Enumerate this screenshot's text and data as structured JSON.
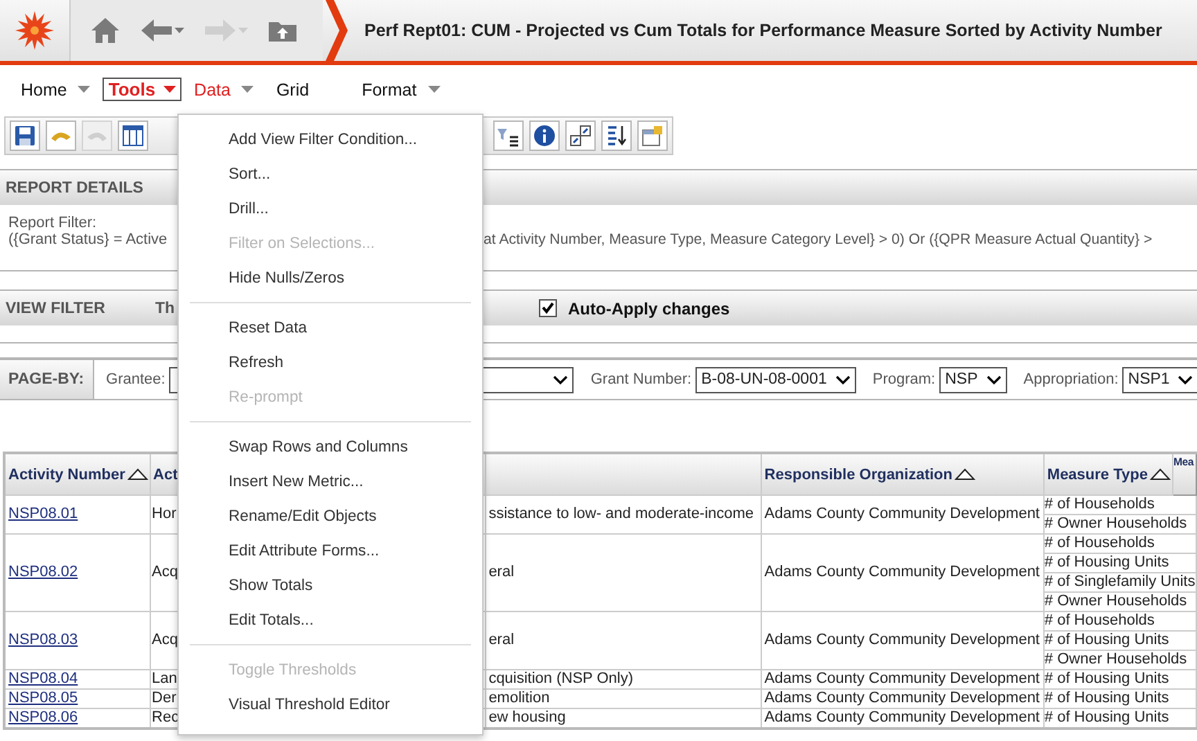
{
  "window": {
    "title": "Perf Rept01: CUM - Projected vs Cum Totals for Performance Measure Sorted by Activity Number"
  },
  "nav_buttons": [
    {
      "kind": "home",
      "disabled": false,
      "caret": false
    },
    {
      "kind": "back",
      "disabled": false,
      "caret": true
    },
    {
      "kind": "forward",
      "disabled": true,
      "caret": true
    },
    {
      "kind": "folder-up",
      "disabled": false,
      "caret": false
    }
  ],
  "menu_bar": [
    {
      "label": "Home",
      "selected": false,
      "highlighted": false,
      "dropdown": true
    },
    {
      "label": "Tools",
      "selected": true,
      "highlighted": false,
      "dropdown": true
    },
    {
      "label": "Data",
      "selected": false,
      "highlighted": true,
      "dropdown": true
    },
    {
      "label": "Grid",
      "selected": false,
      "highlighted": false,
      "dropdown": false
    },
    {
      "label": "Format",
      "selected": false,
      "highlighted": false,
      "dropdown": true
    }
  ],
  "toolbar_left": [
    {
      "kind": "save",
      "disabled": false
    },
    {
      "kind": "undo",
      "disabled": false
    },
    {
      "kind": "redo",
      "disabled": true
    },
    {
      "kind": "columns",
      "disabled": false
    }
  ],
  "toolbar_right": [
    {
      "kind": "filter-list",
      "disabled": false
    },
    {
      "kind": "info",
      "disabled": false
    },
    {
      "kind": "resize",
      "disabled": false
    },
    {
      "kind": "sort",
      "disabled": false
    },
    {
      "kind": "properties",
      "disabled": false
    }
  ],
  "data_menu": [
    [
      {
        "label": "Add View Filter Condition...",
        "disabled": false
      },
      {
        "label": "Sort...",
        "disabled": false
      },
      {
        "label": "Drill...",
        "disabled": false
      },
      {
        "label": "Filter on Selections...",
        "disabled": true
      },
      {
        "label": "Hide Nulls/Zeros",
        "disabled": false
      }
    ],
    [
      {
        "label": "Reset Data",
        "disabled": false
      },
      {
        "label": "Refresh",
        "disabled": false
      },
      {
        "label": "Re-prompt",
        "disabled": true
      }
    ],
    [
      {
        "label": "Swap Rows and Columns",
        "disabled": false
      },
      {
        "label": "Insert New Metric...",
        "disabled": false
      },
      {
        "label": "Rename/Edit Objects",
        "disabled": false
      },
      {
        "label": "Edit Attribute Forms...",
        "disabled": false
      },
      {
        "label": "Show Totals",
        "disabled": false
      },
      {
        "label": "Edit Totals...",
        "disabled": false
      }
    ],
    [
      {
        "label": "Toggle Thresholds",
        "disabled": true
      },
      {
        "label": "Visual Threshold Editor",
        "disabled": false
      }
    ]
  ],
  "report_details": {
    "title": "REPORT DETAILS",
    "filter_label": "Report Filter:",
    "filter_text_left": "({Grant Status} = Active",
    "filter_text_right": "at Activity Number, Measure Type, Measure Category Level} > 0) Or ({QPR Measure Actual Quantity} >"
  },
  "view_filter": {
    "title": "VIEW FILTER",
    "text": "Th",
    "auto_apply": {
      "label": "Auto-Apply changes",
      "checked": true
    }
  },
  "page_by": {
    "label": "PAGE-BY:",
    "selectors": [
      {
        "label": "Grantee:"
      },
      {
        "label": "Grant Number:",
        "value": "B-08-UN-08-0001"
      },
      {
        "label": "Program:",
        "value": "NSP"
      },
      {
        "label": "Appropriation:",
        "value": "NSP1"
      }
    ]
  },
  "table": {
    "columns": [
      {
        "label": "Activity Number",
        "sort_icon": true
      },
      {
        "label": "Act"
      },
      {
        "sort_icon": false
      },
      {
        "label": "Responsible Organization",
        "sort_icon": true
      },
      {
        "label": "Measure Type",
        "sort_icon": true
      },
      {
        "label": "Mea"
      }
    ],
    "rows": [
      {
        "activity_number": "NSP08.01",
        "column_2": "Hor",
        "column_3": "ssistance to low- and moderate-income",
        "organization": "Adams County Community Development",
        "measure_types": [
          "# of Households",
          "# Owner Households"
        ]
      },
      {
        "activity_number": "NSP08.02",
        "column_2": "Acq",
        "column_3": "eral",
        "organization": "Adams County Community Development",
        "measure_types": [
          "# of Households",
          "# of Housing Units",
          "# of Singlefamily Units",
          "# Owner Households"
        ]
      },
      {
        "activity_number": "NSP08.03",
        "column_2": "Acq",
        "column_3": "eral",
        "organization": "Adams County Community Development",
        "measure_types": [
          "# of Households",
          "# of Housing Units",
          "# Owner Households"
        ]
      },
      {
        "activity_number": "NSP08.04",
        "column_2": "Lan",
        "column_3": "cquisition (NSP Only)",
        "organization": "Adams County Community Development",
        "measure_types": [
          "# of Housing Units"
        ]
      },
      {
        "activity_number": "NSP08.05",
        "column_2": "Der",
        "column_3": "emolition",
        "organization": "Adams County Community Development",
        "measure_types": [
          "# of Housing Units"
        ]
      },
      {
        "activity_number": "NSP08.06",
        "column_2": "Rec",
        "column_3": "ew housing",
        "organization": "Adams County Community Development",
        "measure_types": [
          "# of Housing Units"
        ]
      }
    ]
  }
}
